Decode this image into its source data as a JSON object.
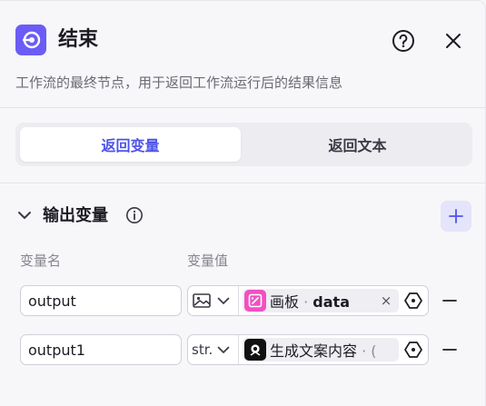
{
  "header": {
    "title": "结束",
    "description": "工作流的最终节点，用于返回工作流运行后的结果信息",
    "node_icon": "end-node-icon",
    "help_icon": "help-circle-icon",
    "close_icon": "close-icon"
  },
  "tabs": [
    {
      "label": "返回变量",
      "active": true
    },
    {
      "label": "返回文本",
      "active": false
    }
  ],
  "output_section": {
    "title": "输出变量",
    "columns": {
      "name": "变量名",
      "value": "变量值"
    },
    "rows": [
      {
        "name": "output",
        "type_icon": "image-type-icon",
        "type_label": "",
        "ref_icon": "canvas-node-icon",
        "ref_icon_color": "#f150c2",
        "ref_node": "画板",
        "separator": "·",
        "ref_field": "data",
        "tag_close": "×"
      },
      {
        "name": "output1",
        "type_icon": "",
        "type_label": "str.",
        "ref_icon": "generate-node-icon",
        "ref_icon_color": "#111111",
        "ref_node": "生成文案内容",
        "separator": "·",
        "ref_field": "(",
        "tag_close": ""
      }
    ]
  },
  "colors": {
    "accent": "#4d53e8",
    "node_icon_bg": "#6b5cf6",
    "add_button_bg": "#e4e4fb"
  }
}
